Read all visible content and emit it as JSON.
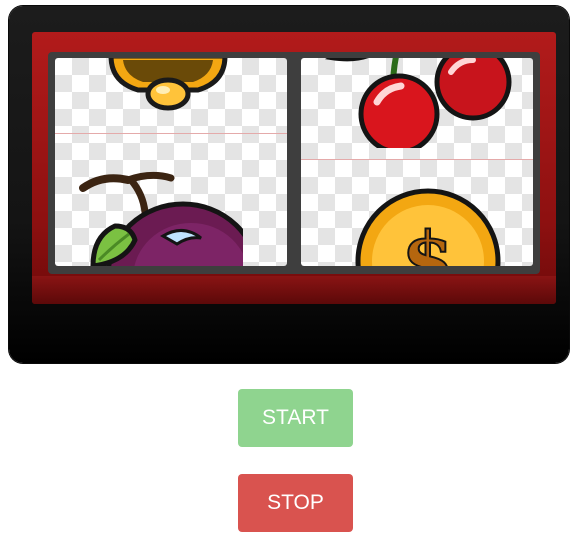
{
  "machine": {
    "reels": [
      {
        "name": "reel-1",
        "symbols": [
          "bell-icon",
          "plum-icon"
        ]
      },
      {
        "name": "reel-2",
        "symbols": [
          "cherries-icon",
          "dollar-coin-icon"
        ]
      }
    ]
  },
  "controls": {
    "start_label": "START",
    "stop_label": "STOP"
  },
  "colors": {
    "start_button": "#8fd48f",
    "stop_button": "#d9534f",
    "frame": "#a01414",
    "cabinet": "#141414"
  }
}
